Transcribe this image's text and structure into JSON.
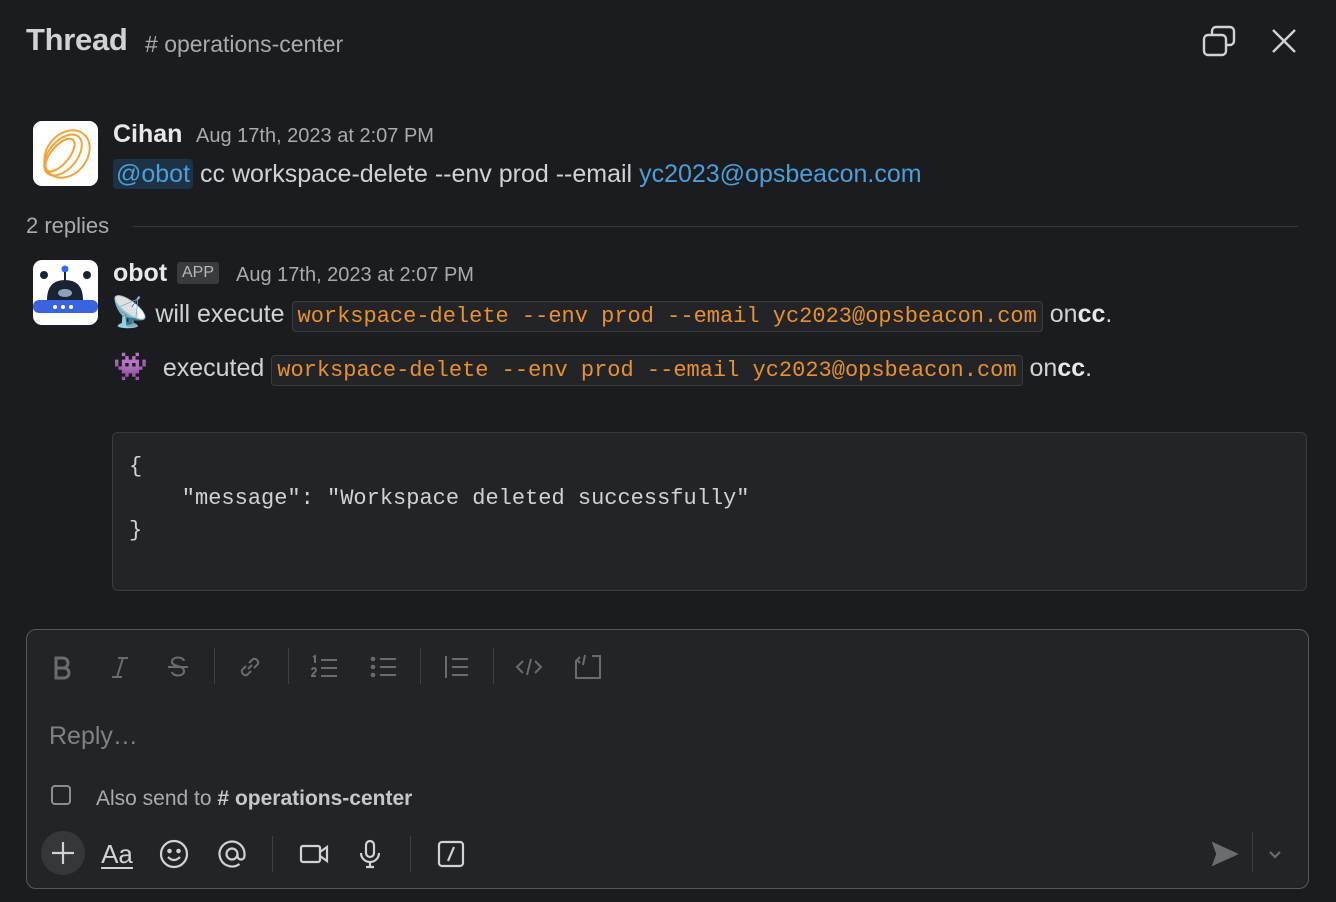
{
  "header": {
    "title": "Thread",
    "channel_hash": "#",
    "channel": "operations-center"
  },
  "messages": [
    {
      "author": "Cihan",
      "timestamp": "Aug 17th, 2023 at 2:07 PM",
      "mention": "@obot",
      "text": "cc workspace-delete --env prod --email",
      "link": "yc2023@opsbeacon.com"
    }
  ],
  "replies_label": "2 replies",
  "reply": {
    "author": "obot",
    "badge": "APP",
    "timestamp": "Aug 17th, 2023 at 2:07 PM",
    "line1": {
      "emoji": "📡",
      "prefix": "will execute",
      "code": "workspace-delete --env prod --email yc2023@opsbeacon.com",
      "on": "on",
      "target": "cc",
      "suffix": "."
    },
    "line2": {
      "emoji": "👾",
      "prefix": "executed",
      "code": "workspace-delete --env prod --email yc2023@opsbeacon.com",
      "on": "on",
      "target": "cc",
      "suffix": "."
    },
    "code_block": "{\n    \"message\": \"Workspace deleted successfully\"\n}"
  },
  "composer": {
    "placeholder": "Reply…",
    "also_send_prefix": "Also send to",
    "also_send_hash": "#",
    "also_send_channel": "operations-center",
    "format_label": "Aa"
  },
  "icons": {
    "header": [
      "expand-window-icon",
      "close-icon"
    ],
    "formatting": [
      "bold-icon",
      "italic-icon",
      "strikethrough-icon",
      "link-icon",
      "ordered-list-icon",
      "bulleted-list-icon",
      "blockquote-icon",
      "code-icon",
      "code-block-icon"
    ],
    "bottom": [
      "plus-icon",
      "format-icon",
      "emoji-icon",
      "mention-icon",
      "video-icon",
      "microphone-icon",
      "slash-command-icon",
      "send-icon",
      "chevron-down-icon"
    ]
  },
  "colors": {
    "background": "#1b1c1f",
    "link": "#4a9fd8",
    "code": "#e8912d"
  }
}
